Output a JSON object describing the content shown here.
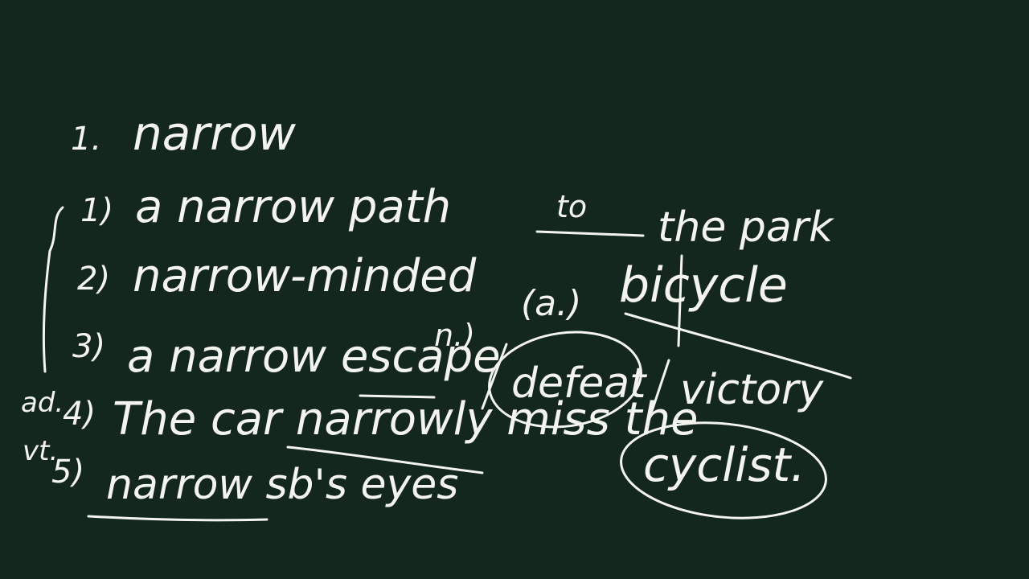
{
  "board": {
    "background_color": "#13271f",
    "ink_color": "#f4f4ef",
    "lines": [
      {
        "num": "1.",
        "text": "narrow"
      },
      {
        "num": "1)",
        "text": "a narrow path",
        "extra": "to",
        "tail": "the park"
      },
      {
        "num": "2)",
        "text": "narrow-minded",
        "pos": "(a.)",
        "word": "bicycle"
      },
      {
        "num": "3)",
        "text": "a narrow escape",
        "pos": "n.)",
        "alt1": "defeat",
        "alt2": "victory"
      },
      {
        "num": "4)",
        "prefix": "ad.",
        "text": "The car narrowly miss the",
        "word": "cyclist."
      },
      {
        "num": "5)",
        "prefix": "vt.",
        "text": "narrow sb's eyes"
      }
    ]
  }
}
